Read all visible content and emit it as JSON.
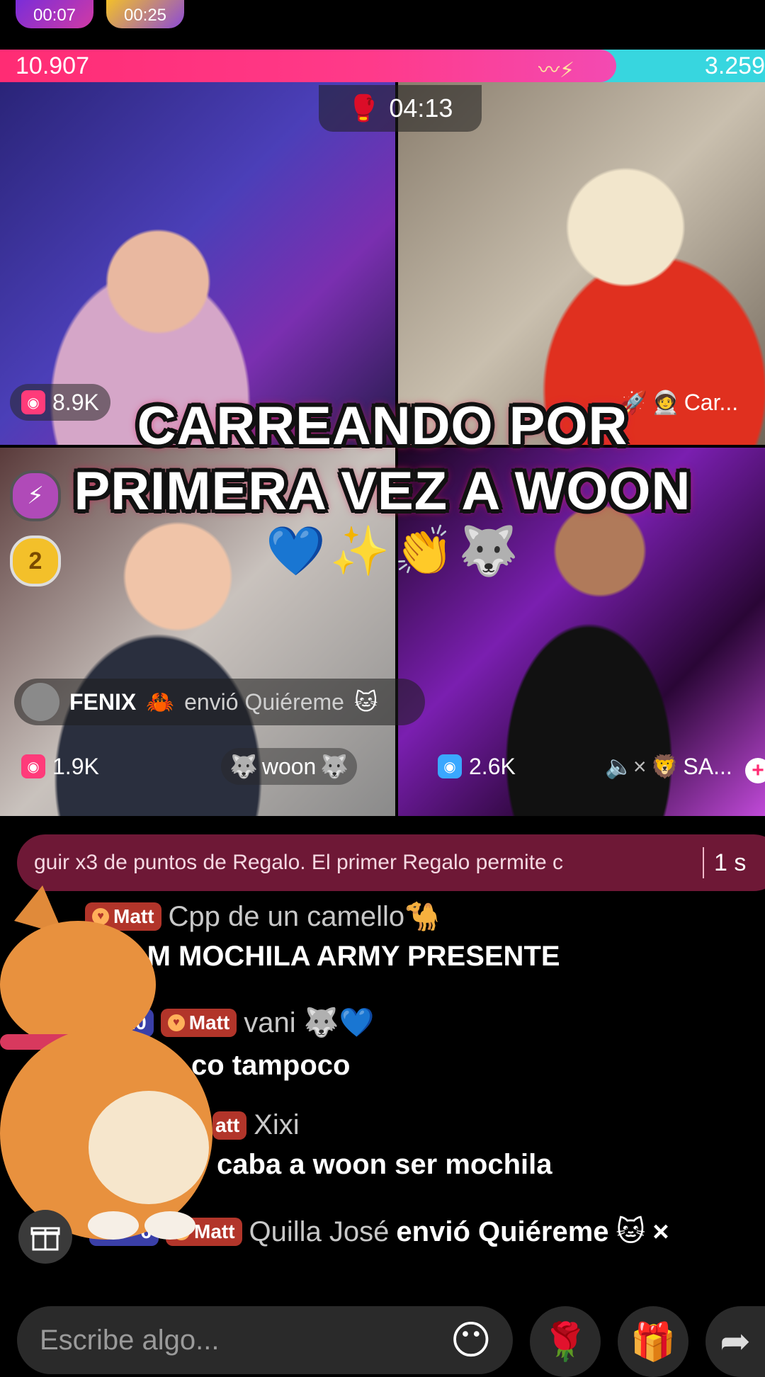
{
  "top_timers": [
    "00:07",
    "00:25"
  ],
  "battle": {
    "score_left": "10.907",
    "score_right": "3.259",
    "countdown": "04:13"
  },
  "tiles": [
    {
      "score": "8.9K",
      "badge_color": "#ff3b7a",
      "name": ""
    },
    {
      "score": "",
      "name": "Car..."
    },
    {
      "score": "1.9K",
      "badge_color": "#ff3b7a",
      "name": "woon"
    },
    {
      "score": "2.6K",
      "badge_color": "#3aa8ff",
      "name": "SA..."
    }
  ],
  "overlay": {
    "line1": "CARREANDO POR",
    "line2": "PRIMERA VEZ A WOON",
    "emojis": "💙✨👏🐺"
  },
  "side_badges": [
    "⚡",
    "2"
  ],
  "gift_notice": {
    "user": "FENIX",
    "action": "envió Quiéreme"
  },
  "ticker": {
    "text": "guir x3 de puntos de Regalo.     El primer Regalo permite c",
    "time": "1 s"
  },
  "chat": [
    {
      "fan": "Matt",
      "level": "",
      "name": "Cpp de un camello🐪",
      "msg": ""
    },
    {
      "fan": "",
      "level": "",
      "name": "",
      "msg": "EAM MOCHILA ARMY PRESENTE"
    },
    {
      "fan": "Matt",
      "level": "20",
      "name": "vani 🐺💙",
      "msg": ""
    },
    {
      "fan": "",
      "level": "",
      "name": "",
      "msg": "co tampoco"
    },
    {
      "fan": "att",
      "level": "",
      "name": "Xixi",
      "msg": ""
    },
    {
      "fan": "",
      "level": "",
      "name": "",
      "msg": "caba a woon ser mochila"
    },
    {
      "fan": "Matt",
      "level": "6",
      "name": "Quilla José",
      "msg": "envió Quiéreme",
      "suffix": "×"
    }
  ],
  "input": {
    "placeholder": "Escribe algo..."
  },
  "colors": {
    "accent_pink": "#ff2c74",
    "accent_cyan": "#37d6df",
    "ticker_bg": "#6e1836"
  }
}
